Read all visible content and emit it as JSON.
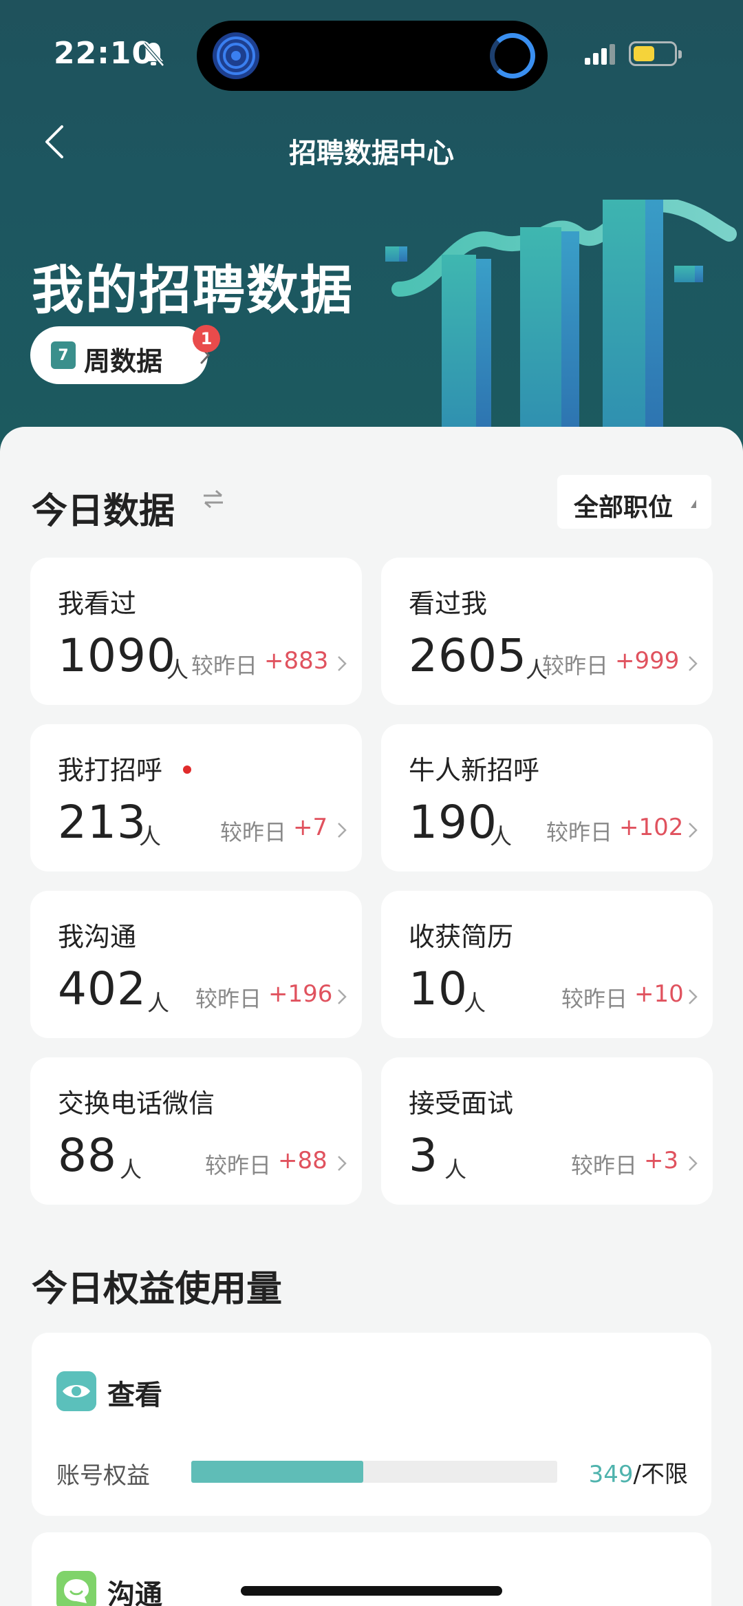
{
  "status_bar": {
    "time": "22:10"
  },
  "nav": {
    "title": "招聘数据中心"
  },
  "hero": {
    "title": "我的招聘数据",
    "week_button": "周数据",
    "week_badge": "1",
    "calendar_digit": "7"
  },
  "today": {
    "title": "今日数据",
    "position_filter": "全部职位",
    "cards": [
      {
        "label": "我看过",
        "value": "1090",
        "unit": "人",
        "compare": "较昨日",
        "delta": "+883"
      },
      {
        "label": "看过我",
        "value": "2605",
        "unit": "人",
        "compare": "较昨日",
        "delta": "+999"
      },
      {
        "label": "我打招呼",
        "value": "213",
        "unit": "人",
        "compare": "较昨日",
        "delta": "+7"
      },
      {
        "label": "牛人新招呼",
        "value": "190",
        "unit": "人",
        "compare": "较昨日",
        "delta": "+102"
      },
      {
        "label": "我沟通",
        "value": "402",
        "unit": "人",
        "compare": "较昨日",
        "delta": "+196"
      },
      {
        "label": "收获简历",
        "value": "10",
        "unit": "人",
        "compare": "较昨日",
        "delta": "+10"
      },
      {
        "label": "交换电话微信",
        "value": "88",
        "unit": "人",
        "compare": "较昨日",
        "delta": "+88"
      },
      {
        "label": "接受面试",
        "value": "3",
        "unit": "人",
        "compare": "较昨日",
        "delta": "+3"
      }
    ]
  },
  "benefits": {
    "title": "今日权益使用量",
    "items": [
      {
        "name": "查看",
        "row_label": "账号权益",
        "used": "349",
        "limit": "/不限",
        "progress": 0.47
      },
      {
        "name": "沟通"
      }
    ]
  },
  "colors": {
    "accent": "#5fbdb7",
    "delta_red": "#e0525e",
    "hero_bg": "#1d5660"
  }
}
